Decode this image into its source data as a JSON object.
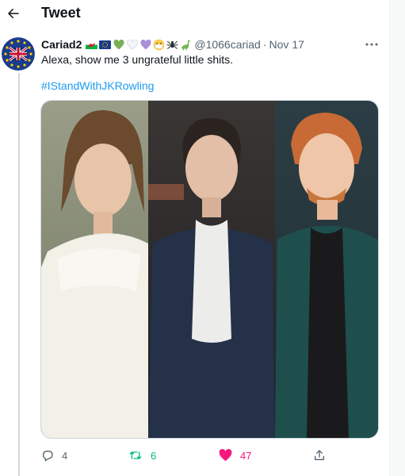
{
  "header": {
    "title": "Tweet"
  },
  "tweet": {
    "display_name": "Cariad2",
    "handle": "@1066cariad",
    "separator": "·",
    "date": "Nov 17",
    "text": "Alexa, show me 3 ungrateful little shits.",
    "hashtag": "#IStandWithJKRowling",
    "name_emojis": [
      "welsh-flag-emoji",
      "eu-flag-emoji",
      "green-heart-emoji",
      "white-heart-emoji",
      "purple-heart-emoji",
      "mask-face-emoji",
      "spider-emoji",
      "dinosaur-emoji"
    ]
  },
  "actions": {
    "replies": "4",
    "retweets": "6",
    "likes": "47"
  },
  "colors": {
    "link": "#1d9bf0",
    "retweet": "#00ba7c",
    "like": "#f91880",
    "muted": "#536471"
  }
}
